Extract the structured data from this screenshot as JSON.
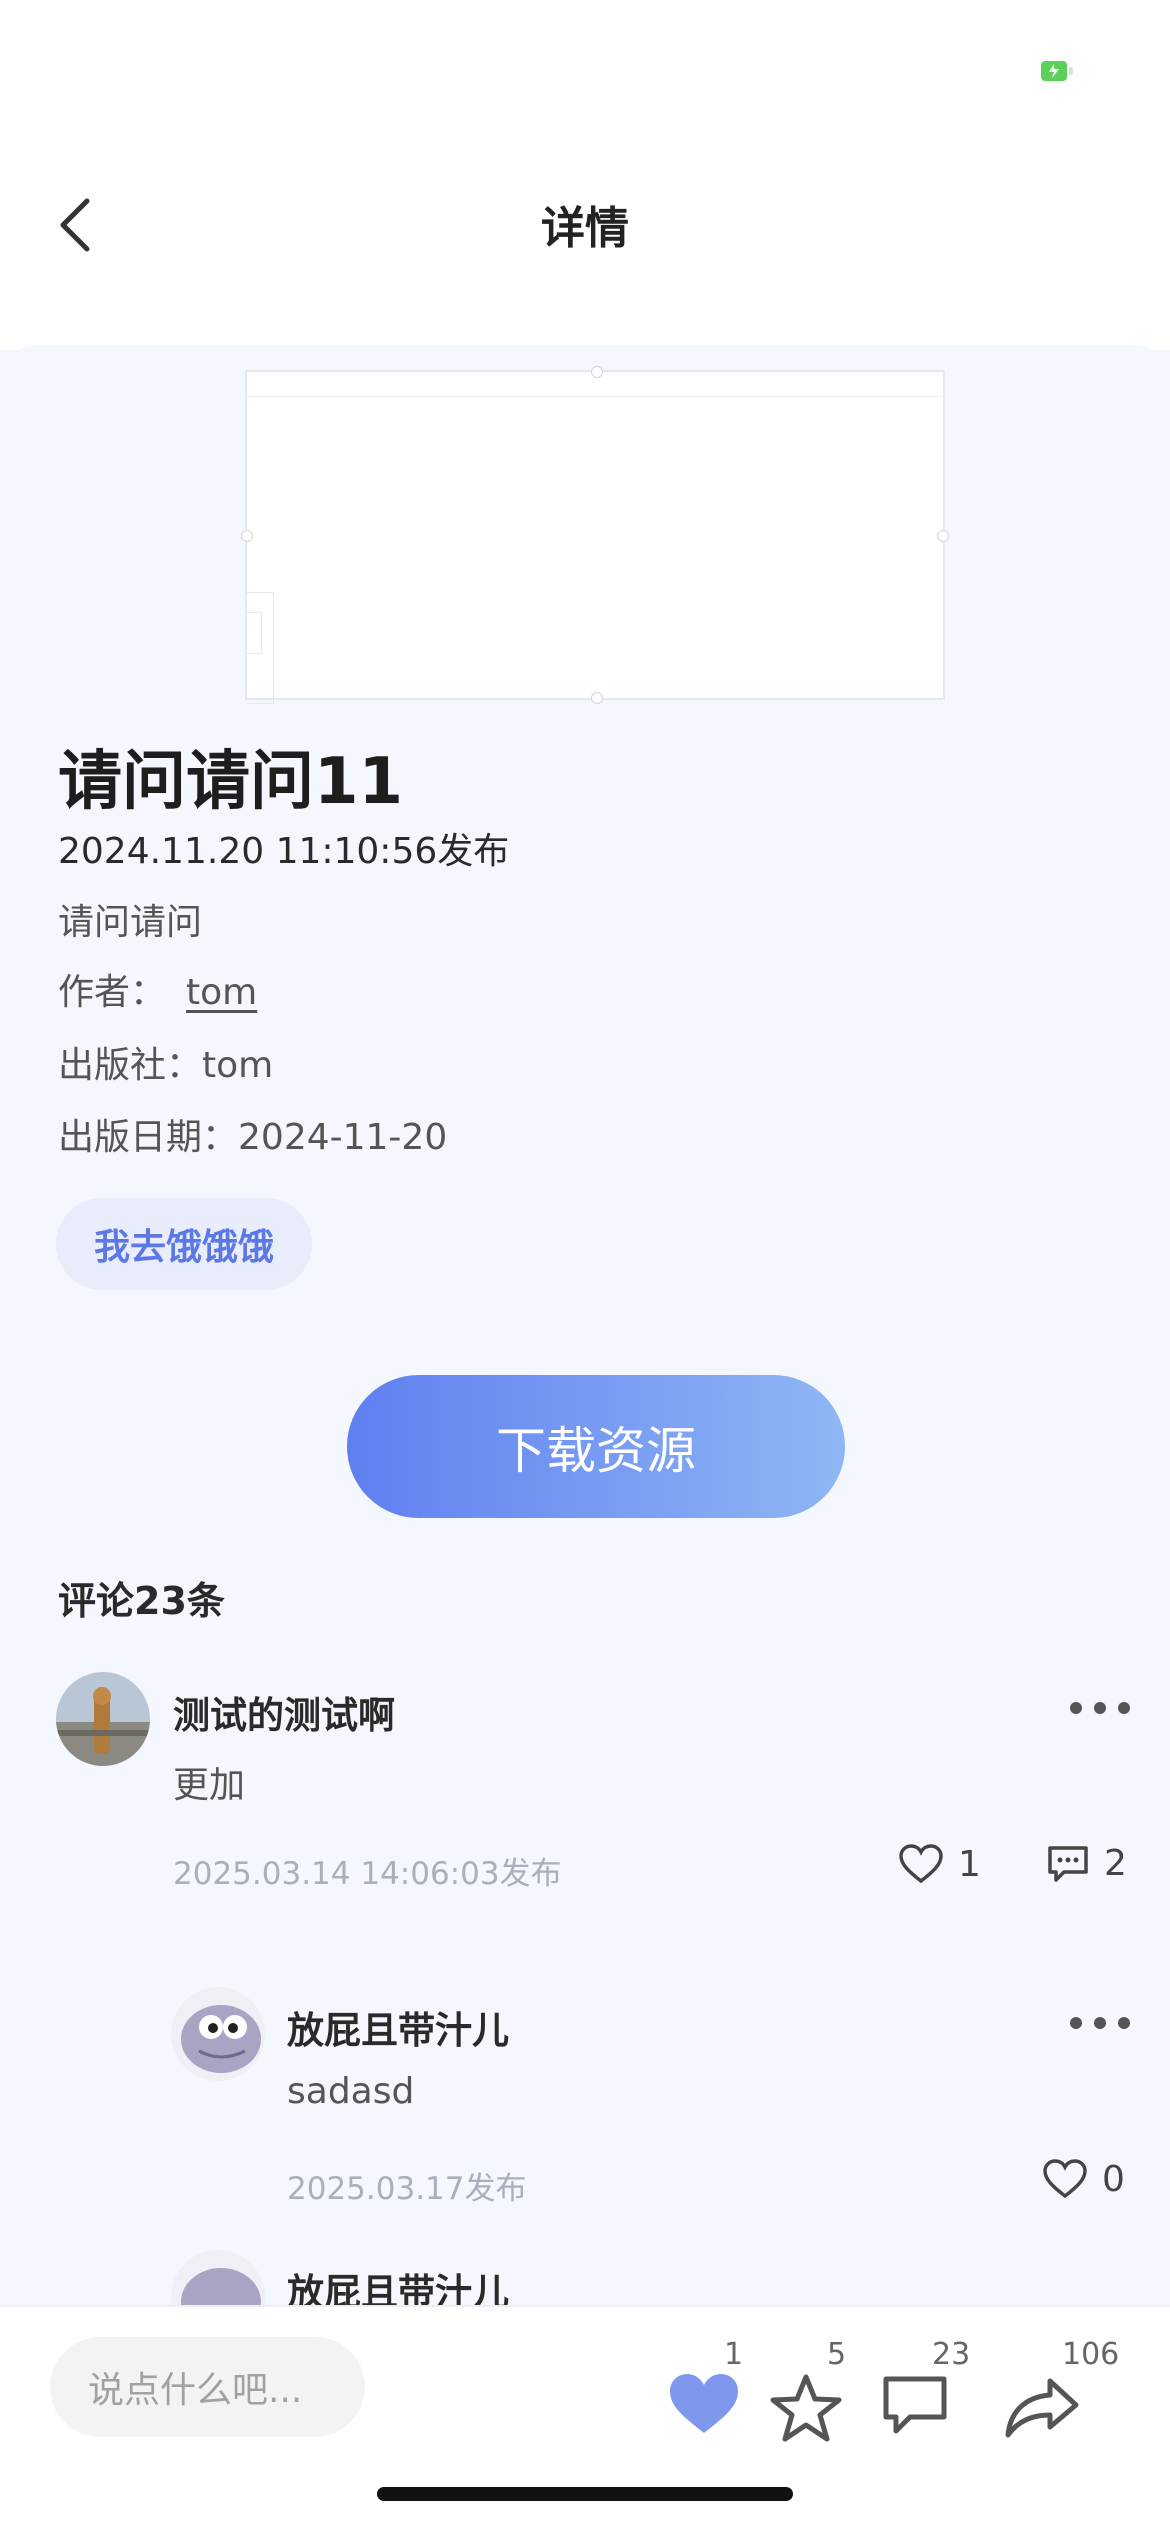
{
  "nav": {
    "title": "详情"
  },
  "book": {
    "title": "请问请问11",
    "published": "2024.11.20 11:10:56发布",
    "description": "请问请问",
    "author_label": "作者：",
    "author": "tom",
    "publisher_label": "出版社：",
    "publisher": "tom",
    "pubdate_label": "出版日期：",
    "pubdate": "2024-11-20",
    "tag": "我去饿饿饿",
    "download_label": "下载资源"
  },
  "comments": {
    "header": "评论23条",
    "items": [
      {
        "user": "测试的测试啊",
        "text": "更加",
        "time": "2025.03.14 14:06:03发布",
        "likes": "1",
        "replies": "2"
      },
      {
        "user": "放屁且带汁儿",
        "text": "sadasd",
        "time": "2025.03.17发布",
        "likes": "0"
      },
      {
        "user": "放屁且带汁儿"
      }
    ]
  },
  "bottom": {
    "placeholder": "说点什么吧...",
    "like_count": "1",
    "fav_count": "5",
    "comment_count": "23",
    "share_count": "106"
  },
  "colors": {
    "accent": "#5f7ff0",
    "tag_bg": "#e9ecfb",
    "battery": "#5bd15b"
  }
}
